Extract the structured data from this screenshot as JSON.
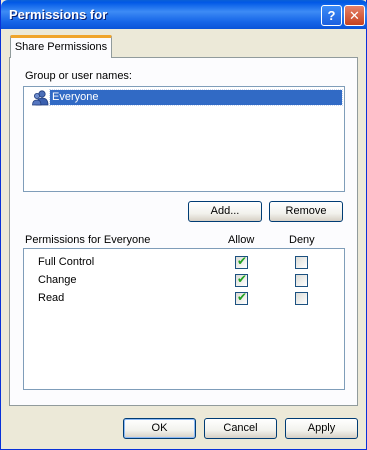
{
  "window": {
    "title": "Permissions for",
    "help_label": "?",
    "close_label": "✕"
  },
  "tabs": [
    {
      "label": "Share Permissions"
    }
  ],
  "group_list": {
    "label": "Group or user names:",
    "items": [
      {
        "name": "Everyone",
        "icon": "user-group-icon",
        "selected": true
      }
    ]
  },
  "group_buttons": {
    "add_label": "Add...",
    "remove_label": "Remove"
  },
  "permissions": {
    "header": "Permissions for Everyone",
    "allow_header": "Allow",
    "deny_header": "Deny",
    "rows": [
      {
        "name": "Full Control",
        "allow": true,
        "deny": false
      },
      {
        "name": "Change",
        "allow": true,
        "deny": false
      },
      {
        "name": "Read",
        "allow": true,
        "deny": false
      }
    ]
  },
  "footer": {
    "ok_label": "OK",
    "cancel_label": "Cancel",
    "apply_label": "Apply"
  },
  "colors": {
    "titlebar": "#0a5fd6",
    "selection": "#316ac5",
    "check": "#21a121",
    "dialog_bg": "#ece9d8"
  }
}
